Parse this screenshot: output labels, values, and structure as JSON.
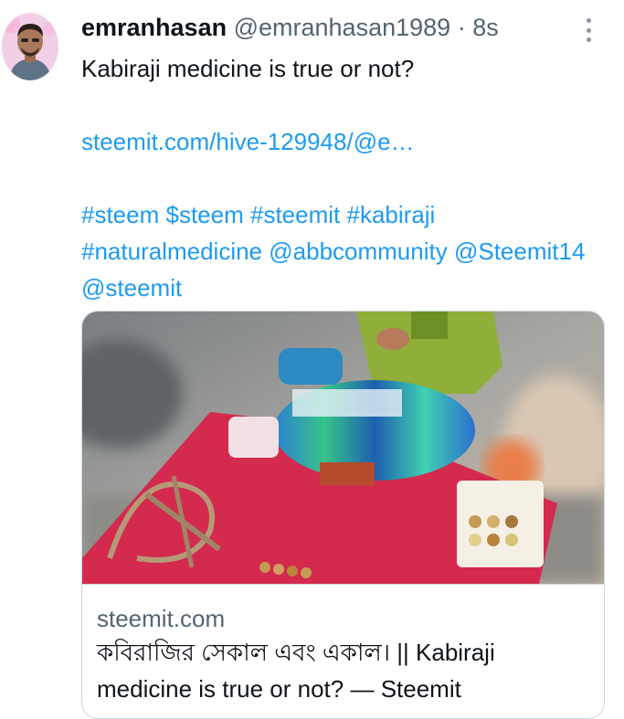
{
  "tweet": {
    "author_name": "emranhasan",
    "author_handle": "@emranhasan1989",
    "separator": "·",
    "time": "8s",
    "text": "Kabiraji medicine is true or not?",
    "link": "steemit.com/hive-129948/@e…",
    "hashtags": [
      {
        "text": "#steem"
      },
      {
        "text": "$steem"
      },
      {
        "text": "#steemit"
      },
      {
        "text": "#kabiraji"
      },
      {
        "text": "#naturalmedicine"
      },
      {
        "text": "@abbcommunity"
      },
      {
        "text": "@Steemit14"
      },
      {
        "text": "@steemit"
      }
    ]
  },
  "card": {
    "domain": "steemit.com",
    "title": "কবিরাজির সেকাল এবং একাল। || Kabiraji medicine is true or not? — Steemit"
  },
  "colors": {
    "link": "#1d9bf0",
    "secondary_text": "#536471",
    "border": "#cfd9de"
  },
  "icons": {
    "more": "more-vertical-icon"
  }
}
